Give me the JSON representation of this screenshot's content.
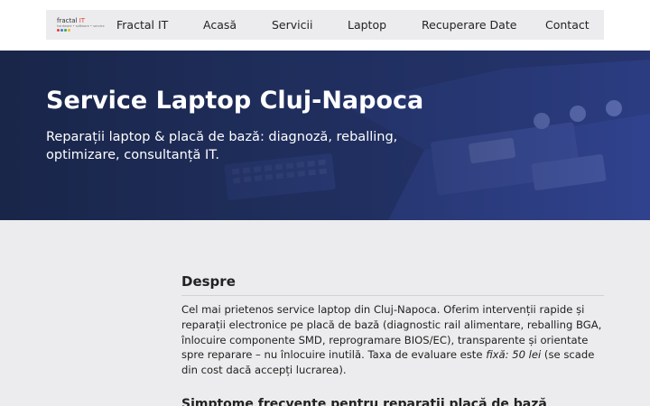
{
  "nav": {
    "logo": {
      "word": "fractal",
      "accent": "IT",
      "tagline": "hardware • software • service"
    },
    "items": [
      "Fractal IT",
      "Acasă",
      "Servicii",
      "Laptop",
      "Recuperare Date",
      "Contact"
    ]
  },
  "hero": {
    "title": "Service Laptop Cluj-Napoca",
    "subtitle": "Reparații laptop & placă de bază: diagnoză, reballing, optimizare, consultanță IT."
  },
  "about": {
    "title": "Despre",
    "text_before": "Cel mai prietenos service laptop din Cluj-Napoca. Oferim intervenții rapide și reparații electronice pe placă de bază (diagnostic rail alimentare, reballing BGA, înlocuire componente SMD, reprogramare BIOS/EC), transparente și orientate spre reparare – nu înlocuire inutilă. Taxa de evaluare este ",
    "text_emphasis": "fixă: 50 lei",
    "text_after": " (se scade din cost dacă accepți lucrarea)."
  },
  "next_section": {
    "title": "Simptome frecvente pentru reparații placă de bază"
  },
  "colors": {
    "accent": "#e0412b",
    "hero_dark": "#1c2a4e",
    "nav_bg": "#ececee"
  }
}
